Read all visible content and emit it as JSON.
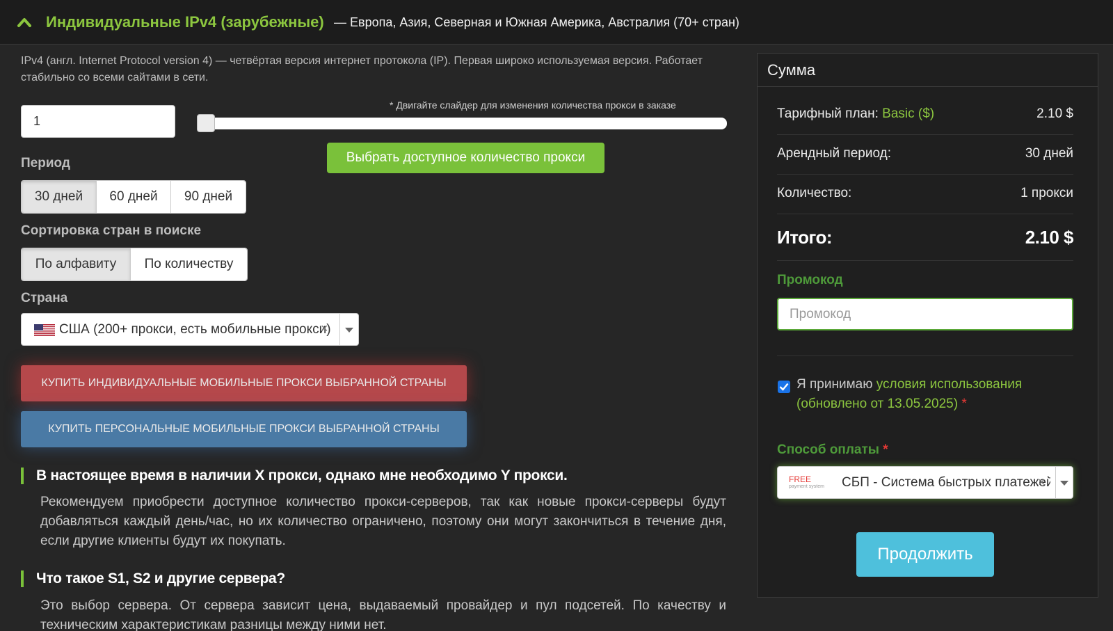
{
  "header": {
    "title": "Индивидуальные IPv4 (зарубежные)",
    "subtitle": "— Европа, Азия, Северная и Южная Америка, Австралия (70+ стран)"
  },
  "intro": "IPv4 (англ. Internet Protocol version 4) — четвёртая версия интернет протокола (IP). Первая широко используемая версия. Работает стабильно со всеми сайтами в сети.",
  "quantity": {
    "value": "1",
    "slider_hint": "* Двигайте слайдер для изменения количества прокси в заказе",
    "slider_fraction": 0,
    "available_button": "Выбрать доступное количество прокси"
  },
  "period": {
    "label": "Период",
    "options": [
      "30 дней",
      "60 дней",
      "90 дней"
    ],
    "selected": "30 дней"
  },
  "sorting": {
    "label": "Сортировка стран в поиске",
    "options": [
      "По алфавиту",
      "По количеству"
    ],
    "selected": "По алфавиту"
  },
  "country": {
    "label": "Страна",
    "value": "США (200+ прокси, есть мобильные прокси)"
  },
  "buttons": {
    "buy_mobile_individual": "КУПИТЬ ИНДИВИДУАЛЬНЫЕ МОБИЛЬНЫЕ ПРОКСИ ВЫБРАННОЙ СТРАНЫ",
    "buy_mobile_personal": "КУПИТЬ ПЕРСОНАЛЬНЫЕ МОБИЛЬНЫЕ ПРОКСИ ВЫБРАННОЙ СТРАНЫ"
  },
  "faq": [
    {
      "q": "В настоящее время в наличии X прокси, однако мне необходимо Y прокси.",
      "a": "Рекомендуем приобрести доступное количество прокси-серверов, так как новые прокси-серверы будут добавляться каждый день/час, но их количество ограничено, поэтому они могут закончиться в течение дня, если другие клиенты будут их покупать."
    },
    {
      "q": "Что такое S1, S2 и другие сервера?",
      "a": "Это выбор сервера. От сервера зависит цена, выдаваемый провайдер и пул подсетей. По качеству и техническим характеристикам разницы между ними нет."
    }
  ],
  "summary": {
    "title": "Сумма",
    "plan_label": "Тарифный план:",
    "plan_name": "Basic ($)",
    "plan_price": "2.10 $",
    "period_label": "Арендный период:",
    "period_value": "30 дней",
    "qty_label": "Количество:",
    "qty_value": "1 прокси",
    "total_label": "Итого:",
    "total_value": "2.10 $",
    "promo_label": "Промокод",
    "promo_placeholder": "Промокод",
    "terms_prefix": "Я принимаю",
    "terms_link": "условия использования (обновлено от 13.05.2025)",
    "required_star": "*",
    "payment_label": "Способ оплаты",
    "payment_logo_main": "FREE",
    "payment_logo_sub": "payment system",
    "payment_value": "СБП - Система быстрых платежей",
    "continue_button": "Продолжить"
  },
  "colors": {
    "accent_green": "#8cc63f",
    "buy_red": "#b5484b",
    "buy_blue": "#4a7aa5",
    "continue_blue": "#4ec0dc"
  }
}
